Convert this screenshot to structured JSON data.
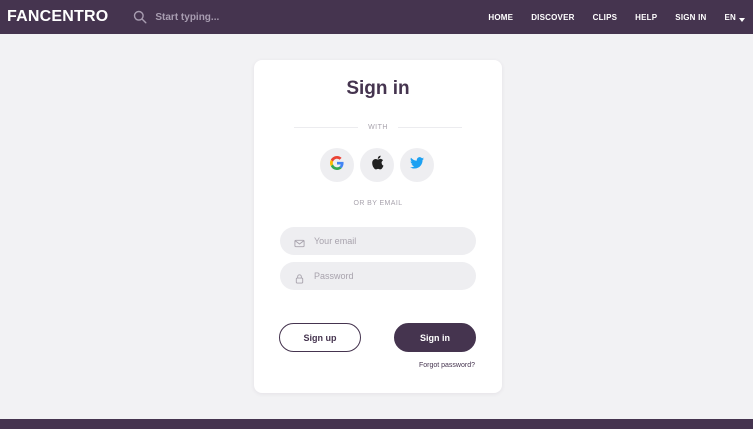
{
  "header": {
    "logo": "FANCENTRO",
    "search_placeholder": "Start typing...",
    "nav": {
      "home": "HOME",
      "discover": "DISCOVER",
      "clips": "CLIPS",
      "help": "HELP",
      "sign_in": "SIGN IN",
      "language": "EN"
    }
  },
  "card": {
    "title": "Sign in",
    "with_label": "WITH",
    "social_icons": [
      "google-icon",
      "apple-icon",
      "twitter-icon"
    ],
    "or_email_label": "OR BY EMAIL",
    "email_placeholder": "Your email",
    "password_placeholder": "Password",
    "signup_label": "Sign up",
    "signin_label": "Sign in",
    "forgot_label": "Forgot password?"
  },
  "colors": {
    "brand": "#45344f",
    "field_bg": "#eeeef1",
    "page_bg": "#f2f2f4",
    "twitter": "#1da1f2"
  }
}
